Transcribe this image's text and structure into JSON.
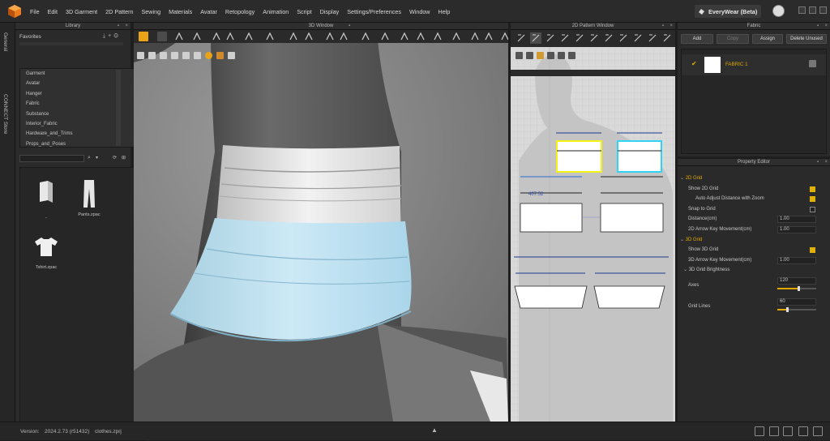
{
  "app": {
    "menus": [
      "File",
      "Edit",
      "3D Garment",
      "2D Pattern",
      "Sewing",
      "Materials",
      "Avatar",
      "Retopology",
      "Animation",
      "Script",
      "Display",
      "Settings/Preferences",
      "Window",
      "Help"
    ],
    "brand": "EveryWear (Beta)"
  },
  "side_tabs": [
    "General",
    "CONNECT Store"
  ],
  "library": {
    "title": "Library",
    "favorites_label": "Favorites",
    "tree": [
      "Garment",
      "Avatar",
      "Hanger",
      "Fabric",
      "Substance",
      "Interior_Fabric",
      "Hardware_and_Trims",
      "Props_and_Poses"
    ],
    "files": [
      {
        "label": "..",
        "icon": "folder-icon"
      },
      {
        "label": "Pants.zpac",
        "icon": "pants-icon"
      },
      {
        "label": "Tshirt.zpac",
        "icon": "tshirt-icon"
      }
    ]
  },
  "view3d": {
    "title": "3D Window"
  },
  "pattern": {
    "title": "2D Pattern Window",
    "measure": "407.52"
  },
  "fabric": {
    "title": "Fabric",
    "buttons": [
      "Add",
      "Copy",
      "Assign",
      "Delete Unused"
    ],
    "items": [
      {
        "name": "FABRIC 1"
      }
    ]
  },
  "property_editor": {
    "title": "Property Editor",
    "rows": [
      {
        "label": "2D Grid",
        "kind": "section"
      },
      {
        "label": "Show 2D Grid",
        "kind": "check",
        "checked": true
      },
      {
        "label": "Auto Adjust Distance with Zoom",
        "kind": "check",
        "checked": true
      },
      {
        "label": "Snap to Grid",
        "kind": "check",
        "checked": false
      },
      {
        "label": "Distance(cm)",
        "kind": "value",
        "value": "1.00"
      },
      {
        "label": "2D Arrow Key Movement(cm)",
        "kind": "value",
        "value": "1.00"
      },
      {
        "label": "3D Grid",
        "kind": "section"
      },
      {
        "label": "Show 3D Grid",
        "kind": "check",
        "checked": true
      },
      {
        "label": "3D Arrow Key Movement(cm)",
        "kind": "value",
        "value": "1.00"
      },
      {
        "label": "3D Grid Brightness",
        "kind": "section2"
      },
      {
        "label": "Axes",
        "kind": "slider",
        "value": "120",
        "level": 0.55
      },
      {
        "label": "Grid Lines",
        "kind": "slider",
        "value": "60",
        "level": 0.27
      }
    ]
  },
  "status": {
    "version_label": "Version:",
    "version": "2024.2.73 (r51432)",
    "file": "clothes.zprj"
  },
  "colors": {
    "accent": "#e0a800",
    "selected_outline": "#f3f31a",
    "cyan_outline": "#30d5f5"
  }
}
